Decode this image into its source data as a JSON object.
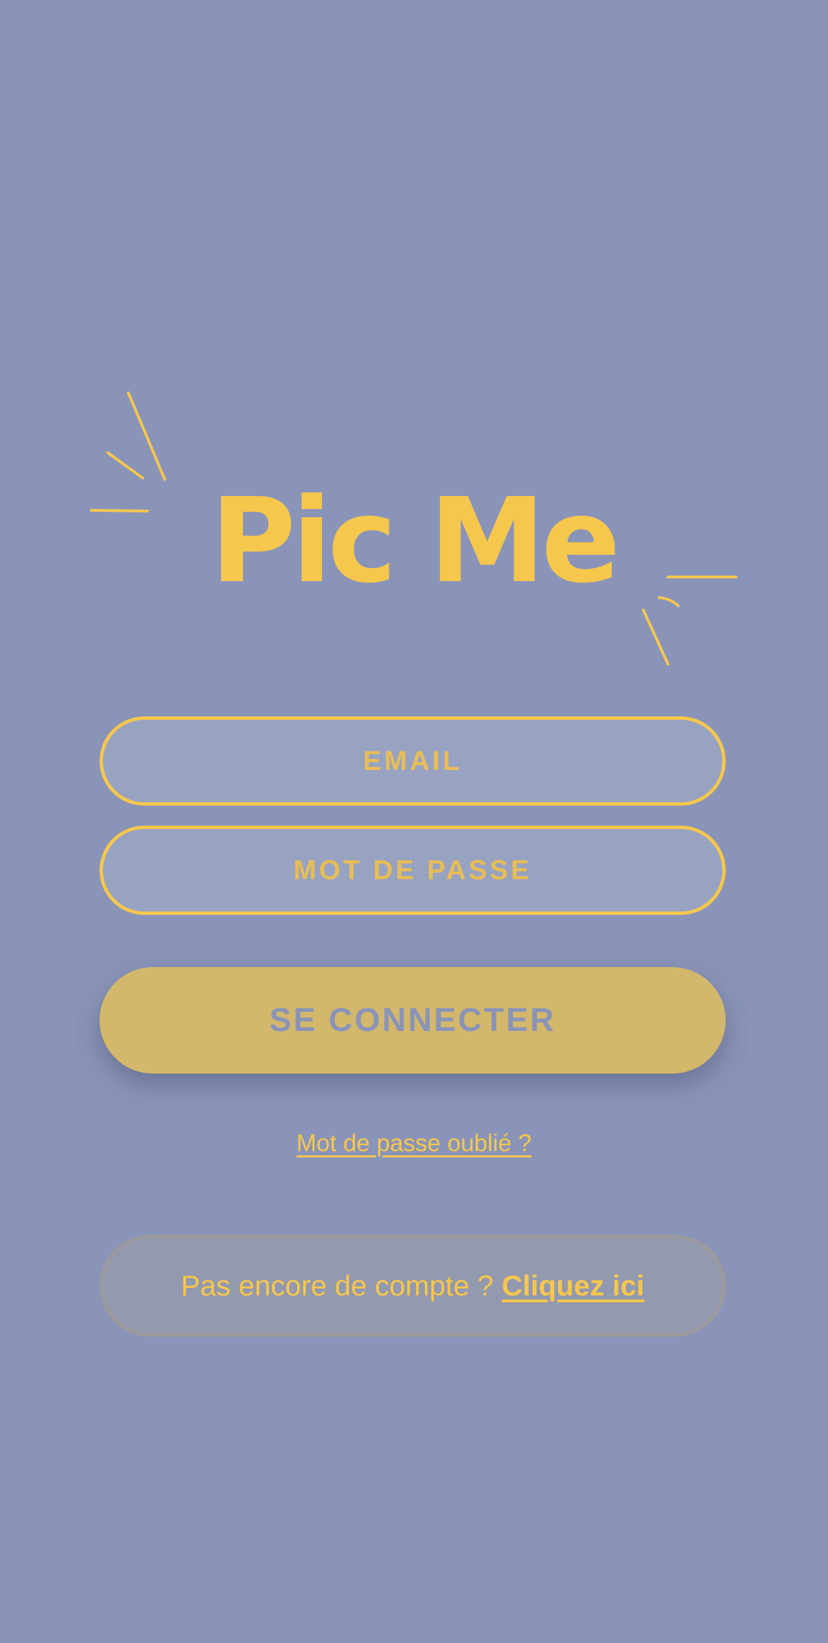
{
  "logo": {
    "text": "Pic Me"
  },
  "form": {
    "email_placeholder": "EMAIL",
    "password_placeholder": "MOT DE PASSE",
    "login_label": "SE CONNECTER",
    "forgot_label": "Mot de passe oublié ?"
  },
  "signup": {
    "prompt": "Pas encore de compte ?",
    "link": "Cliquez ici"
  },
  "colors": {
    "background": "#8994b8",
    "accent": "#f6c74d",
    "button": "#d3b76b"
  }
}
